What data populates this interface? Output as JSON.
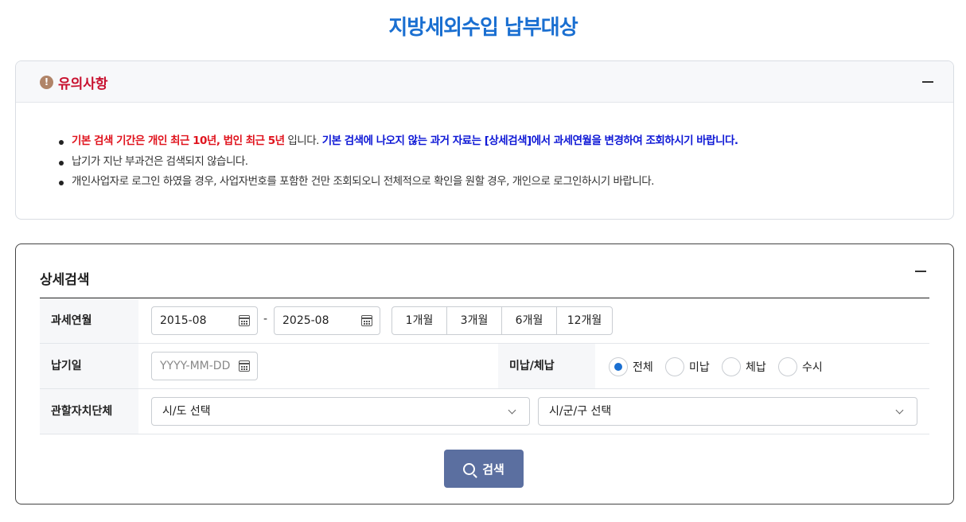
{
  "page": {
    "title": "지방세외수입 납부대상"
  },
  "notice": {
    "title": "유의사항",
    "line1_red": "기본 검색 기간은 개인 최근 10년, 법인 최근 5년",
    "line1_mid": " 입니다. ",
    "line1_blue": "기본 검색에 나오지 않는 과거 자료는 [상세검색]에서 과세연월을 변경하여 조회하시기 바랍니다.",
    "line2": "납기가 지난 부과건은 검색되지 않습니다.",
    "line3": "개인사업자로 로그인 하였을 경우, 사업자번호를 포함한 건만 조회되오니 전체적으로 확인을 원할 경우, 개인으로 로그인하시기 바랍니다."
  },
  "search": {
    "title": "상세검색",
    "tax_month": {
      "label": "과세연월",
      "from": "2015-08",
      "separator": "-",
      "to": "2025-08",
      "periods": [
        "1개월",
        "3개월",
        "6개월",
        "12개월"
      ]
    },
    "due_date": {
      "label": "납기일",
      "placeholder": "YYYY-MM-DD"
    },
    "status": {
      "label": "미납/체납",
      "options": [
        "전체",
        "미납",
        "체납",
        "수시"
      ],
      "selected": "전체"
    },
    "jurisdiction": {
      "label": "관할자치단체",
      "sido": "시/도 선택",
      "sigungu": "시/군/구 선택"
    },
    "button_label": "검색"
  },
  "colors": {
    "title": "#1a6fd1",
    "alert_red": "#e0141e",
    "alert_blue": "#0f19d6",
    "button": "#5b6fa0"
  }
}
